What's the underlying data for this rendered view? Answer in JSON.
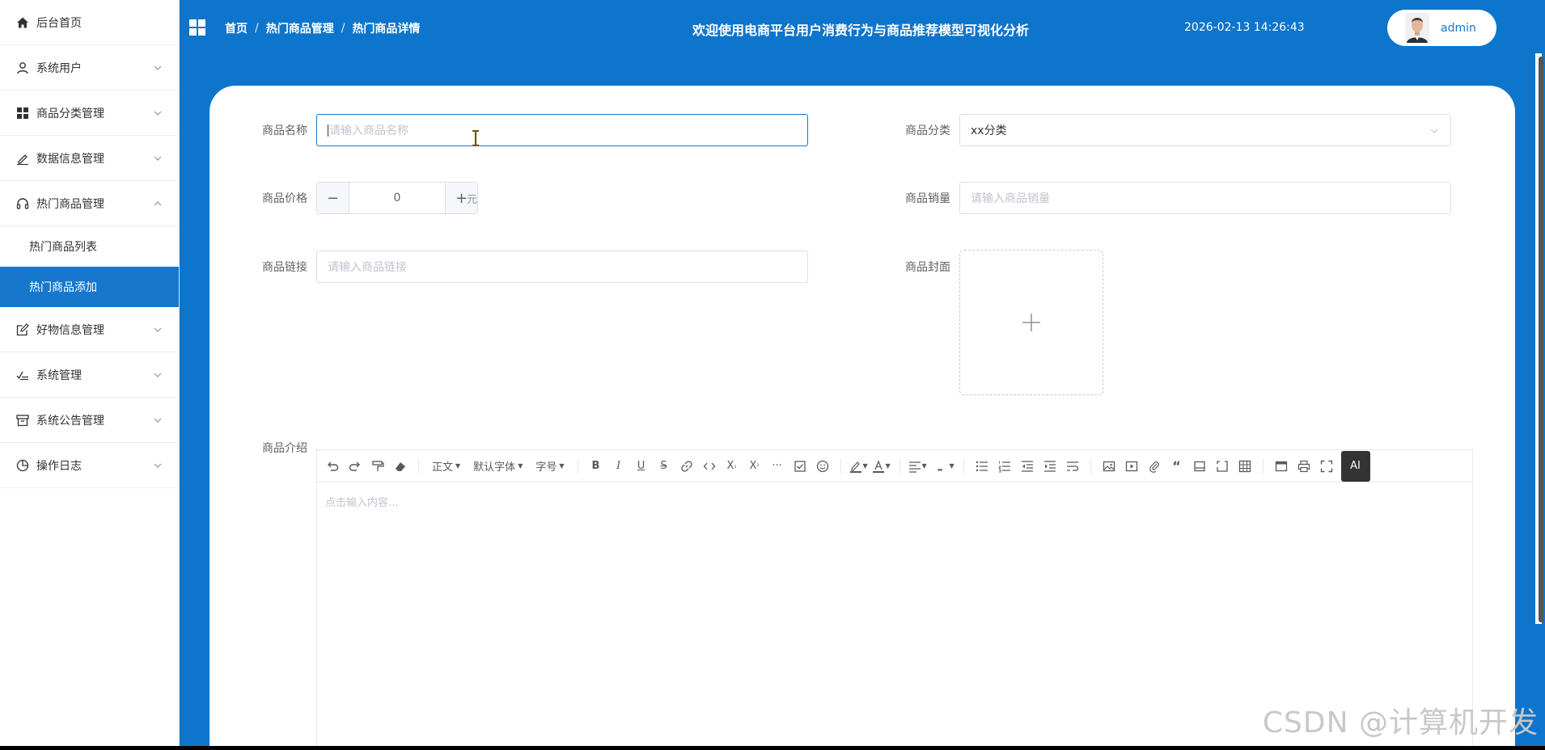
{
  "sidebar": {
    "items": [
      {
        "label": "后台首页"
      },
      {
        "label": "系统用户"
      },
      {
        "label": "商品分类管理"
      },
      {
        "label": "数据信息管理"
      },
      {
        "label": "热门商品管理"
      },
      {
        "label": "好物信息管理"
      },
      {
        "label": "系统管理"
      },
      {
        "label": "系统公告管理"
      },
      {
        "label": "操作日志"
      }
    ],
    "sub_items": [
      {
        "label": "热门商品列表"
      },
      {
        "label": "热门商品添加"
      }
    ]
  },
  "header": {
    "breadcrumb": [
      "首页",
      "热门商品管理",
      "热门商品详情"
    ],
    "welcome": "欢迎使用电商平台用户消费行为与商品推荐模型可视化分析",
    "datetime": "2026-02-13 14:26:43",
    "user": "admin"
  },
  "form": {
    "name": {
      "label": "商品名称",
      "placeholder": "请输入商品名称"
    },
    "category": {
      "label": "商品分类",
      "value": "xx分类"
    },
    "price": {
      "label": "商品价格",
      "value": "0",
      "unit": "元"
    },
    "sales": {
      "label": "商品销量",
      "placeholder": "请输入商品销量"
    },
    "link": {
      "label": "商品链接",
      "placeholder": "请输入商品链接"
    },
    "cover": {
      "label": "商品封面"
    },
    "intro": {
      "label": "商品介绍",
      "placeholder": "点击输入内容..."
    }
  },
  "editor": {
    "heading_select": "正文",
    "font_select": "默认字体",
    "size_select": "字号",
    "ai_label": "AI"
  },
  "watermark": "CSDN @计算机开发"
}
